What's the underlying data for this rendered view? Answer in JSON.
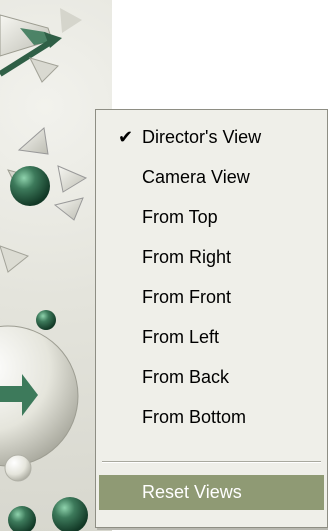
{
  "menu": {
    "checked_index": 0,
    "checkmark_glyph": "✔",
    "items": [
      {
        "label": "Director's View",
        "checked": true
      },
      {
        "label": "Camera View",
        "checked": false
      },
      {
        "label": "From Top",
        "checked": false
      },
      {
        "label": "From Right",
        "checked": false
      },
      {
        "label": "From Front",
        "checked": false
      },
      {
        "label": "From Left",
        "checked": false
      },
      {
        "label": "From Back",
        "checked": false
      },
      {
        "label": "From Bottom",
        "checked": false
      }
    ],
    "reset_label": "Reset Views",
    "highlight_color": "#8f9a74",
    "background_color": "#efefe9"
  },
  "scene": {
    "background_color": "#e6e6de",
    "accent_color": "#3d7a5b",
    "icons": [
      "gizmo-arrow-icon",
      "green-sphere-icon",
      "translate-gizmo-icon",
      "small-sphere-icon",
      "large-sphere-icon",
      "green-arrow-icon"
    ]
  }
}
